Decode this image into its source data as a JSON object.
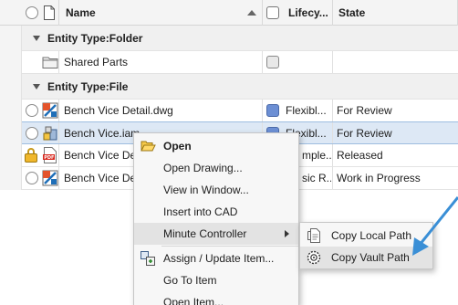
{
  "header": {
    "name": "Name",
    "lifecycle": "Lifecy...",
    "state": "State"
  },
  "groups": [
    {
      "title": "Entity Type:Folder"
    },
    {
      "title": "Entity Type:File"
    }
  ],
  "rows": {
    "folder": {
      "name": "Shared Parts",
      "lifecycle": "",
      "state": ""
    },
    "files": [
      {
        "name": "Bench Vice Detail.dwg",
        "lifecycle": "Flexibl...",
        "state": "For Review"
      },
      {
        "name": "Bench Vice.iam",
        "lifecycle": "Flexibl...",
        "state": "For Review"
      },
      {
        "name": "Bench Vice Det",
        "lifecycle": "mple...",
        "state": "Released"
      },
      {
        "name": "Bench Vice Det",
        "lifecycle": "sic R...",
        "state": "Work in Progress"
      }
    ]
  },
  "context_menu": {
    "items": [
      {
        "label": "Open"
      },
      {
        "label": "Open Drawing..."
      },
      {
        "label": "View in Window..."
      },
      {
        "label": "Insert into CAD"
      },
      {
        "label": "Minute Controller"
      },
      {
        "label": "Assign / Update Item..."
      },
      {
        "label": "Go To Item"
      },
      {
        "label": "Open Item..."
      }
    ]
  },
  "submenu": {
    "items": [
      {
        "label": "Copy Local Path"
      },
      {
        "label": "Copy Vault Path"
      }
    ]
  },
  "colors": {
    "accent_arrow": "#3a8fd6",
    "selection": "#dde8f5",
    "lifecycle_blue": "#6c8fd4"
  }
}
